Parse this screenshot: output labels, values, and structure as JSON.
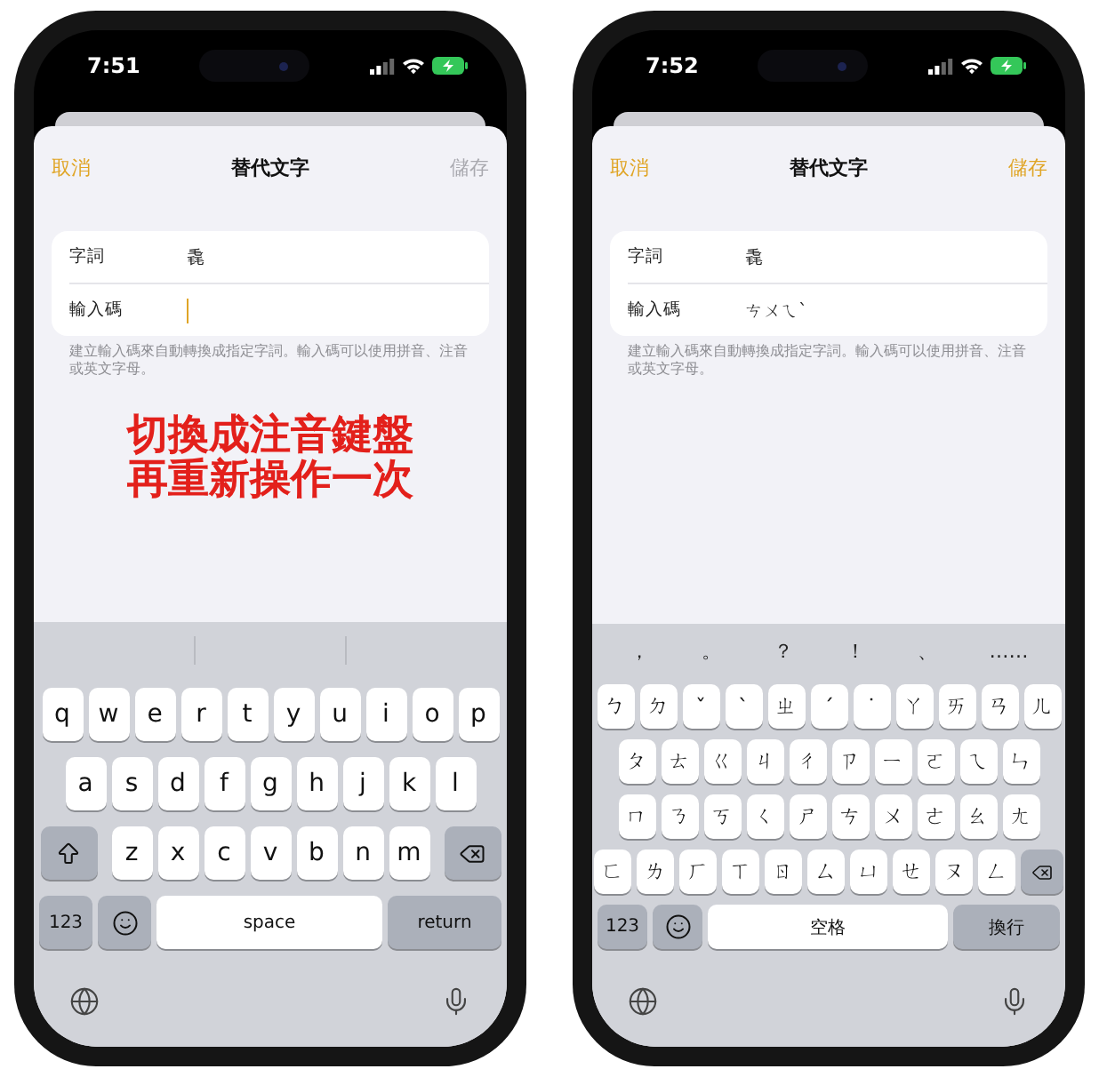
{
  "phones": [
    {
      "time": "7:51",
      "nav": {
        "cancel": "取消",
        "title": "替代文字",
        "save": {
          "label": "儲存",
          "disabled": true
        }
      },
      "form": {
        "rows": [
          {
            "label": "字詞",
            "value": "毳"
          },
          {
            "label": "輸入碼",
            "focused": true
          }
        ],
        "footer": "建立輸入碼來自動轉換成指定字詞。輸入碼可以使用拼音、注音或英文字母。"
      },
      "annotation": [
        "切換成注音鍵盤",
        "再重新操作一次"
      ],
      "keyboard": {
        "kind": "qwerty",
        "rows": [
          {
            "keys": [
              "q",
              "w",
              "e",
              "r",
              "t",
              "y",
              "u",
              "i",
              "o",
              "p"
            ]
          },
          {
            "keys": [
              "a",
              "s",
              "d",
              "f",
              "g",
              "h",
              "j",
              "k",
              "l"
            ]
          },
          {
            "keys": [
              "z",
              "x",
              "c",
              "v",
              "b",
              "n",
              "m"
            ],
            "shift": true,
            "delete": true
          }
        ],
        "bottom": {
          "numbers": "123",
          "space": "space",
          "return": "return"
        }
      }
    },
    {
      "time": "7:52",
      "nav": {
        "cancel": "取消",
        "title": "替代文字",
        "save": {
          "label": "儲存",
          "disabled": false
        }
      },
      "form": {
        "rows": [
          {
            "label": "字詞",
            "value": "毳"
          },
          {
            "label": "輸入碼",
            "value": "ㄘㄨㄟˋ",
            "focused": false
          }
        ],
        "footer": "建立輸入碼來自動轉換成指定字詞。輸入碼可以使用拼音、注音或英文字母。"
      },
      "keyboard": {
        "kind": "zhuyin",
        "punctuation": [
          "，",
          "。",
          "？",
          "！",
          "、",
          "……"
        ],
        "rows": [
          {
            "keys": [
              "ㄅ",
              "ㄉ",
              "ˇ",
              "ˋ",
              "ㄓ",
              "ˊ",
              "˙",
              "ㄚ",
              "ㄞ",
              "ㄢ",
              "ㄦ"
            ]
          },
          {
            "keys": [
              "ㄆ",
              "ㄊ",
              "ㄍ",
              "ㄐ",
              "ㄔ",
              "ㄗ",
              "ㄧ",
              "ㄛ",
              "ㄟ",
              "ㄣ"
            ]
          },
          {
            "keys": [
              "ㄇ",
              "ㄋ",
              "ㄎ",
              "ㄑ",
              "ㄕ",
              "ㄘ",
              "ㄨ",
              "ㄜ",
              "ㄠ",
              "ㄤ"
            ]
          },
          {
            "keys": [
              "ㄈ",
              "ㄌ",
              "ㄏ",
              "ㄒ",
              "ㄖ",
              "ㄙ",
              "ㄩ",
              "ㄝ",
              "ㄡ",
              "ㄥ"
            ],
            "delete": true
          }
        ],
        "bottom": {
          "numbers": "123",
          "space": "空格",
          "return": "換行"
        }
      }
    }
  ]
}
